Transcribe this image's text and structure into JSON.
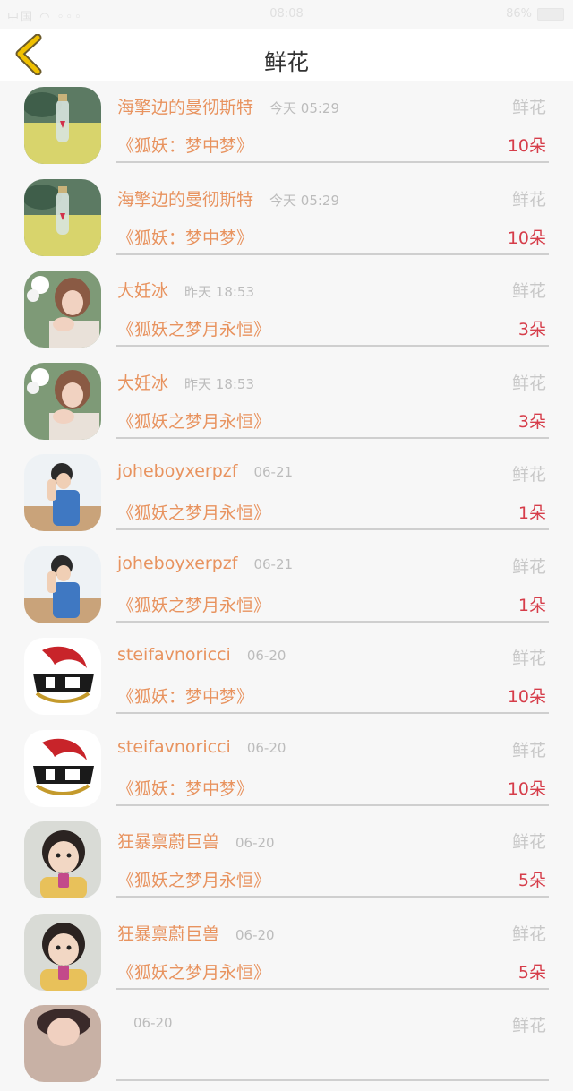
{
  "status_bar": {
    "signal": "中国 ◠ ◦◦◦",
    "time": "08:08",
    "battery_text": "86%"
  },
  "header": {
    "title": "鲜花",
    "back_icon": "chevron-left-icon"
  },
  "colors": {
    "accent": "#e8935f",
    "count": "#d63d4a",
    "back": "#f0b400"
  },
  "list": [
    {
      "name": "海擎边的曼彻斯特",
      "time": "今天 05:29",
      "type": "鲜花",
      "work": "《狐妖：梦中梦》",
      "count": "10朵",
      "avatar": "bottle"
    },
    {
      "name": "海擎边的曼彻斯特",
      "time": "今天 05:29",
      "type": "鲜花",
      "work": "《狐妖：梦中梦》",
      "count": "10朵",
      "avatar": "bottle"
    },
    {
      "name": "大妊冰",
      "time": "昨天 18:53",
      "type": "鲜花",
      "work": "《狐妖之梦月永恒》",
      "count": "3朵",
      "avatar": "girl-flower"
    },
    {
      "name": "大妊冰",
      "time": "昨天 18:53",
      "type": "鲜花",
      "work": "《狐妖之梦月永恒》",
      "count": "3朵",
      "avatar": "girl-flower"
    },
    {
      "name": "joheboyxerpzf",
      "time": "06-21",
      "type": "鲜花",
      "work": "《狐妖之梦月永恒》",
      "count": "1朵",
      "avatar": "boy"
    },
    {
      "name": "joheboyxerpzf",
      "time": "06-21",
      "type": "鲜花",
      "work": "《狐妖之梦月永恒》",
      "count": "1朵",
      "avatar": "boy"
    },
    {
      "name": "steifavnoricci",
      "time": "06-20",
      "type": "鲜花",
      "work": "《狐妖：梦中梦》",
      "count": "10朵",
      "avatar": "dragon-logo"
    },
    {
      "name": "steifavnoricci",
      "time": "06-20",
      "type": "鲜花",
      "work": "《狐妖：梦中梦》",
      "count": "10朵",
      "avatar": "dragon-logo"
    },
    {
      "name": "狂暴禀蔚巨兽",
      "time": "06-20",
      "type": "鲜花",
      "work": "《狐妖之梦月永恒》",
      "count": "5朵",
      "avatar": "child"
    },
    {
      "name": "狂暴禀蔚巨兽",
      "time": "06-20",
      "type": "鲜花",
      "work": "《狐妖之梦月永恒》",
      "count": "5朵",
      "avatar": "child"
    },
    {
      "name": "",
      "time": "06-20",
      "type": "鲜花",
      "work": "",
      "count": "",
      "avatar": "partial"
    }
  ]
}
